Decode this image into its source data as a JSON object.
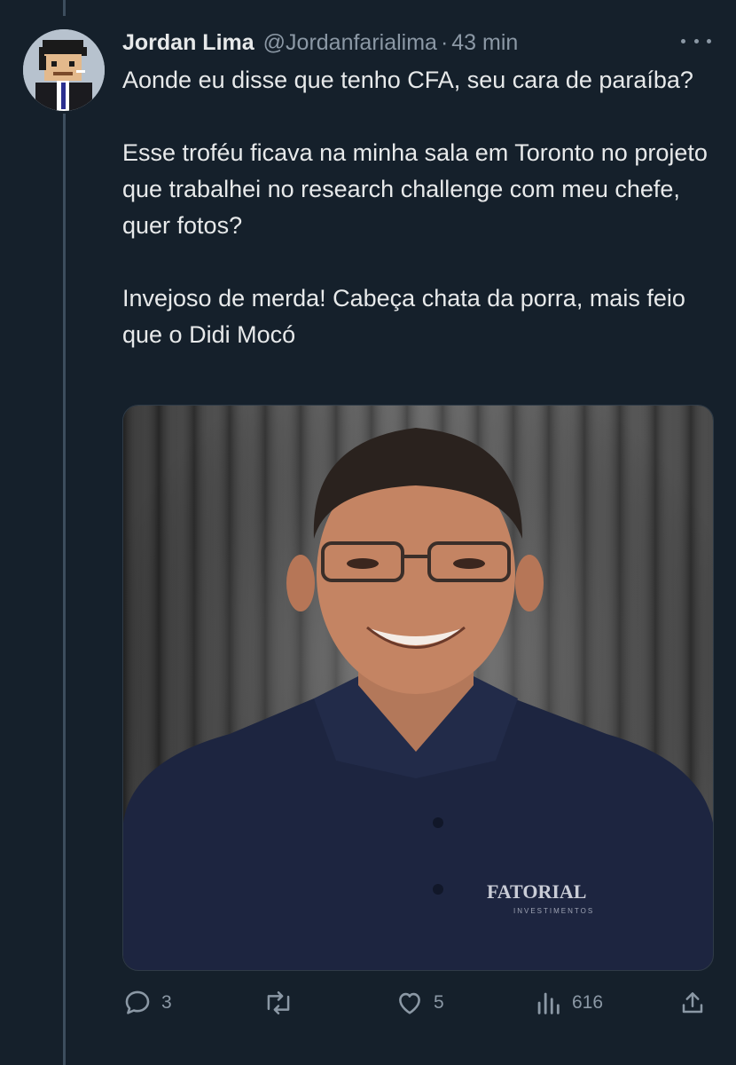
{
  "tweet": {
    "author": {
      "display_name": "Jordan Lima",
      "handle": "@Jordanfarialima",
      "avatar_icon": "pixel-art-avatar"
    },
    "separator": "·",
    "time": "43 min",
    "more_icon": "more-horizontal-icon",
    "text": {
      "para1": "Aonde eu disse que tenho CFA, seu cara de paraíba?",
      "para2": "Esse troféu ficava na minha sala em Toronto no projeto que trabalhei no research challenge com meu chefe, quer fotos?",
      "para3": "Invejoso de merda! Cabeça chata da porra, mais feio que o Didi Mocó"
    },
    "media": {
      "shirt_logo": "FATORIAL",
      "shirt_logo_sub": "INVESTIMENTOS"
    },
    "actions": {
      "reply_count": "3",
      "retweet_count": "",
      "like_count": "5",
      "views_count": "616"
    }
  },
  "colors": {
    "background": "#15202b",
    "text_primary": "#e7e9ea",
    "text_secondary": "#8b98a5",
    "thread_line": "#3d4e5e"
  }
}
